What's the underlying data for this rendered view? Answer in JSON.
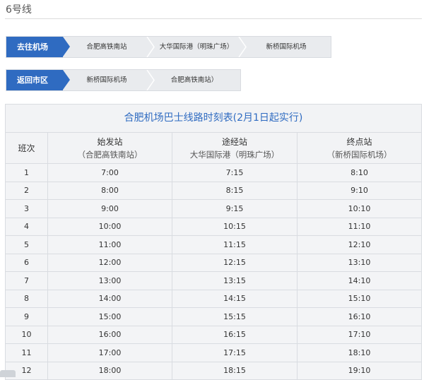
{
  "line": {
    "title": "6号线"
  },
  "routes": [
    {
      "direction": "去往机场",
      "stops": [
        "合肥高铁南站",
        "大华国际港（明珠广场）",
        "新桥国际机场"
      ]
    },
    {
      "direction": "返回市区",
      "stops": [
        "新桥国际机场",
        "合肥高铁南站）"
      ]
    }
  ],
  "timetable": {
    "caption": "合肥机场巴士线路时刻表(2月1日起实行)",
    "headers": {
      "trip": "班次",
      "origin": {
        "label": "始发站",
        "station": "（合肥高铁南站）"
      },
      "via": {
        "label": "途经站",
        "station": "大华国际港（明珠广场）"
      },
      "terminal": {
        "label": "终点站",
        "station": "（新桥国际机场）"
      }
    },
    "rows": [
      {
        "trip": "1",
        "origin": "7:00",
        "via": "7:15",
        "terminal": "8:10"
      },
      {
        "trip": "2",
        "origin": "8:00",
        "via": "8:15",
        "terminal": "9:10"
      },
      {
        "trip": "3",
        "origin": "9:00",
        "via": "9:15",
        "terminal": "10:10"
      },
      {
        "trip": "4",
        "origin": "10:00",
        "via": "10:15",
        "terminal": "11:10"
      },
      {
        "trip": "5",
        "origin": "11:00",
        "via": "11:15",
        "terminal": "12:10"
      },
      {
        "trip": "6",
        "origin": "12:00",
        "via": "12:15",
        "terminal": "13:10"
      },
      {
        "trip": "7",
        "origin": "13:00",
        "via": "13:15",
        "terminal": "14:10"
      },
      {
        "trip": "8",
        "origin": "14:00",
        "via": "14:15",
        "terminal": "15:10"
      },
      {
        "trip": "9",
        "origin": "15:00",
        "via": "15:15",
        "terminal": "16:10"
      },
      {
        "trip": "10",
        "origin": "16:00",
        "via": "16:15",
        "terminal": "17:10"
      },
      {
        "trip": "11",
        "origin": "17:00",
        "via": "17:15",
        "terminal": "18:10"
      },
      {
        "trip": "12",
        "origin": "18:00",
        "via": "18:15",
        "terminal": "19:10"
      }
    ]
  },
  "colors": {
    "accent": "#2f6bc1",
    "route_bg": "#e9ebee",
    "table_bg": "#f3f4f6",
    "border": "#d9dce1"
  }
}
